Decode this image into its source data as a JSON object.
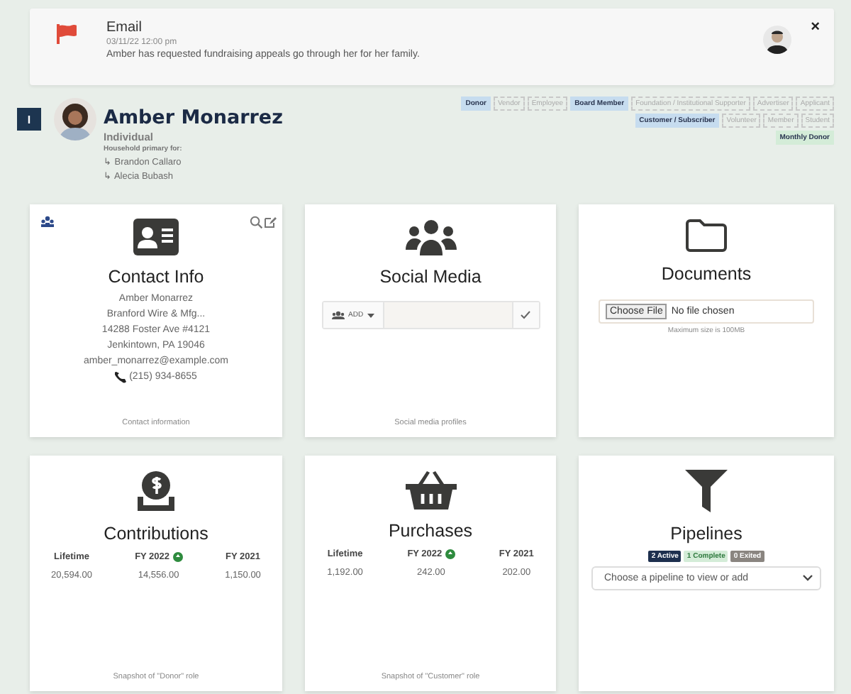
{
  "notification": {
    "title": "Email",
    "date": "03/11/22 12:00 pm",
    "message": "Amber has requested fundraising appeals go through her for her family.",
    "close": "×"
  },
  "profile": {
    "type_badge": "I",
    "name": "Amber Monarrez",
    "type": "Individual",
    "household_label": "Household primary for:",
    "household": [
      {
        "arrow": "↳",
        "name": "Brandon Callaro"
      },
      {
        "arrow": "↳",
        "name": "Alecia Bubash"
      }
    ],
    "tag_rows": [
      [
        {
          "label": "Donor",
          "active": true,
          "color": "#c6dcef"
        },
        {
          "label": "Vendor",
          "active": false
        },
        {
          "label": "Employee",
          "active": false
        },
        {
          "label": "Board Member",
          "active": true,
          "color": "#c6dcef"
        },
        {
          "label": "Foundation / Institutional Supporter",
          "active": false
        },
        {
          "label": "Advertiser",
          "active": false
        },
        {
          "label": "Applicant",
          "active": false
        }
      ],
      [
        {
          "label": "Customer / Subscriber",
          "active": true,
          "color": "#c6dcef"
        },
        {
          "label": "Volunteer",
          "active": false
        },
        {
          "label": "Member",
          "active": false
        },
        {
          "label": "Student",
          "active": false
        }
      ],
      [
        {
          "label": "Monthly Donor",
          "active": true,
          "color": "#d4ecd8"
        }
      ]
    ]
  },
  "cards": [
    {
      "kind": "contact",
      "title": "Contact Info",
      "lines": [
        "Amber Monarrez",
        "Branford Wire & Mfg...",
        "14288 Foster Ave #4121",
        "Jenkintown, PA 19046",
        "amber_monarrez@example.com"
      ],
      "phone": "(215) 934-8655",
      "footer": "Contact information"
    },
    {
      "kind": "social",
      "title": "Social Media",
      "add": "ADD",
      "footer": "Social media profiles"
    },
    {
      "kind": "documents",
      "title": "Documents",
      "file_button": "Choose File",
      "file_status": "No file chosen",
      "hint": "Maximum size is 100MB"
    },
    {
      "kind": "contributions",
      "title": "Contributions",
      "columns": [
        {
          "label": "Lifetime",
          "value": "20,594.00",
          "current": false
        },
        {
          "label": "FY 2022",
          "value": "14,556.00",
          "current": true
        },
        {
          "label": "FY 2021",
          "value": "1,150.00",
          "current": false
        }
      ],
      "footer": "Snapshot of \"Donor\" role"
    },
    {
      "kind": "purchases",
      "title": "Purchases",
      "columns": [
        {
          "label": "Lifetime",
          "value": "1,192.00",
          "current": false
        },
        {
          "label": "FY 2022",
          "value": "242.00",
          "current": true
        },
        {
          "label": "FY 2021",
          "value": "202.00",
          "current": false
        }
      ],
      "footer": "Snapshot of \"Customer\" role"
    },
    {
      "kind": "pipelines",
      "title": "Pipelines",
      "badges": [
        {
          "label": "2 Active",
          "color": "#1d2f4e"
        },
        {
          "label": "1 Complete",
          "color": "#d4ecd8"
        },
        {
          "label": "0 Exited",
          "color": "#8a8580"
        }
      ],
      "placeholder": "Choose a pipeline to view or add"
    }
  ]
}
